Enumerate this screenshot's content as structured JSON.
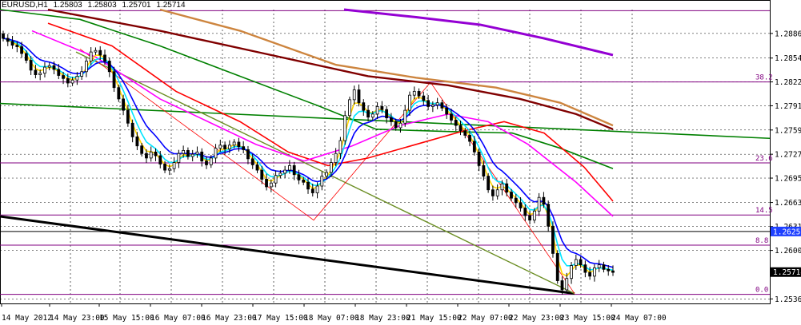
{
  "header": {
    "symbol": "EURUSD,H1",
    "open": "1.25803",
    "high": "1.25803",
    "low": "1.25701",
    "close": "1.25714"
  },
  "colors": {
    "background": "#ffffff",
    "grid": "#000000",
    "bull_candle": "#000000",
    "bear_candle": "#000000",
    "fib_line": "#800080",
    "ma_yellow": "#ffd700",
    "ma_cyan": "#00e5ff",
    "ma_blue": "#0000ff",
    "ma_magenta": "#ff00ff",
    "ma_red": "#ff0000",
    "ma_green": "#008000",
    "ma_orange": "#cd853f",
    "ma_maroon": "#800000",
    "ma_purple": "#9400d3",
    "trend_green": "#008000",
    "trend_black": "#000000",
    "trend_olive": "#6b8e23",
    "zigzag": "#ff0000"
  },
  "chart_data": {
    "type": "candlestick",
    "symbol": "EURUSD",
    "timeframe": "H1",
    "ylim": [
      1.253,
      1.2918
    ],
    "price_ticks": [
      "1.28865",
      "1.28540",
      "1.28225",
      "1.27910",
      "1.27590",
      "1.27270",
      "1.26955",
      "1.26633",
      "1.26315",
      "1.26000",
      "1.25360"
    ],
    "time_ticks": [
      "14 May 2012",
      "14 May 23:00",
      "15 May 15:00",
      "16 May 07:00",
      "16 May 23:00",
      "17 May 15:00",
      "18 May 07:00",
      "18 May 23:00",
      "21 May 15:00",
      "22 May 07:00",
      "22 May 23:00",
      "23 May 15:00",
      "24 May 07:00"
    ],
    "current_price_label": "1.25714",
    "bid_line_label": "1.26250",
    "fib_levels": [
      {
        "label": "38.2",
        "price": 1.28225
      },
      {
        "label": "23.6",
        "price": 1.27155
      },
      {
        "label": "14.5",
        "price": 1.26468
      },
      {
        "label": "8.8",
        "price": 1.2607
      },
      {
        "label": "0.0",
        "price": 1.2542
      }
    ],
    "top_level_price": 1.29165,
    "bid_line_price": 1.2625,
    "current_price": 1.25714,
    "candle_closes": [
      1.288,
      1.2876,
      1.2871,
      1.2869,
      1.286,
      1.2851,
      1.2838,
      1.2832,
      1.2834,
      1.2842,
      1.2844,
      1.2839,
      1.2831,
      1.2827,
      1.2821,
      1.2825,
      1.283,
      1.2836,
      1.285,
      1.2862,
      1.2864,
      1.2858,
      1.285,
      1.2836,
      1.2815,
      1.28,
      1.2785,
      1.2768,
      1.275,
      1.2738,
      1.2728,
      1.2722,
      1.273,
      1.2725,
      1.2714,
      1.2706,
      1.2708,
      1.2716,
      1.2728,
      1.2732,
      1.2724,
      1.2727,
      1.273,
      1.2718,
      1.2713,
      1.2722,
      1.2735,
      1.2739,
      1.2734,
      1.2739,
      1.2743,
      1.2737,
      1.2733,
      1.2721,
      1.2713,
      1.2706,
      1.2694,
      1.2684,
      1.2689,
      1.2699,
      1.2702,
      1.2706,
      1.2712,
      1.27,
      1.2693,
      1.269,
      1.2681,
      1.2676,
      1.2685,
      1.2698,
      1.2703,
      1.2716,
      1.2728,
      1.2745,
      1.2778,
      1.2799,
      1.2812,
      1.2795,
      1.2785,
      1.2776,
      1.278,
      1.279,
      1.2786,
      1.2775,
      1.277,
      1.2762,
      1.2768,
      1.2785,
      1.2805,
      1.281,
      1.2804,
      1.2798,
      1.279,
      1.2792,
      1.2795,
      1.2788,
      1.278,
      1.2772,
      1.2765,
      1.2758,
      1.2752,
      1.2744,
      1.273,
      1.2712,
      1.2698,
      1.268,
      1.2672,
      1.268,
      1.2688,
      1.2677,
      1.2669,
      1.2663,
      1.2656,
      1.2646,
      1.264,
      1.2652,
      1.267,
      1.2661,
      1.2632,
      1.2596,
      1.256,
      1.2548,
      1.2563,
      1.258,
      1.2588,
      1.2581,
      1.2571,
      1.2566,
      1.2577,
      1.2581,
      1.2575,
      1.2573,
      1.2571
    ]
  }
}
